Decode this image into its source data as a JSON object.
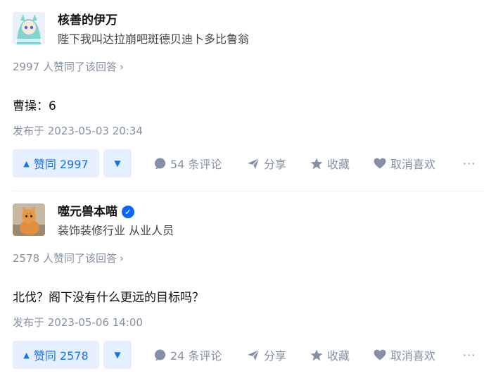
{
  "answers": [
    {
      "author": {
        "name": "核善的伊万",
        "bio": "陛下我叫达拉崩吧斑德贝迪卜多比鲁翁",
        "verified": false,
        "avatar": "anime-avatar"
      },
      "voters_text": "2997 人赞同了该回答",
      "content": "曹操：6",
      "time": "发布于 2023-05-03 20:34",
      "vote_up_label": "赞同 2997",
      "comments_label": "54 条评论",
      "share_label": "分享",
      "collect_label": "收藏",
      "like_label": "取消喜欢",
      "more_label": "···"
    },
    {
      "author": {
        "name": "噬元兽本喵",
        "bio": "装饰装修行业 从业人员",
        "verified": true,
        "avatar": "cat-avatar"
      },
      "voters_text": "2578 人赞同了该回答",
      "content": "北伐？阁下没有什么更远的目标吗？",
      "time": "发布于 2023-05-06 14:00",
      "vote_up_label": "赞同 2578",
      "comments_label": "24 条评论",
      "share_label": "分享",
      "collect_label": "收藏",
      "like_label": "取消喜欢",
      "more_label": "···"
    }
  ],
  "colors": {
    "accent": "#1772f6",
    "accent_bg": "#e5effd",
    "meta": "#8590a6"
  }
}
